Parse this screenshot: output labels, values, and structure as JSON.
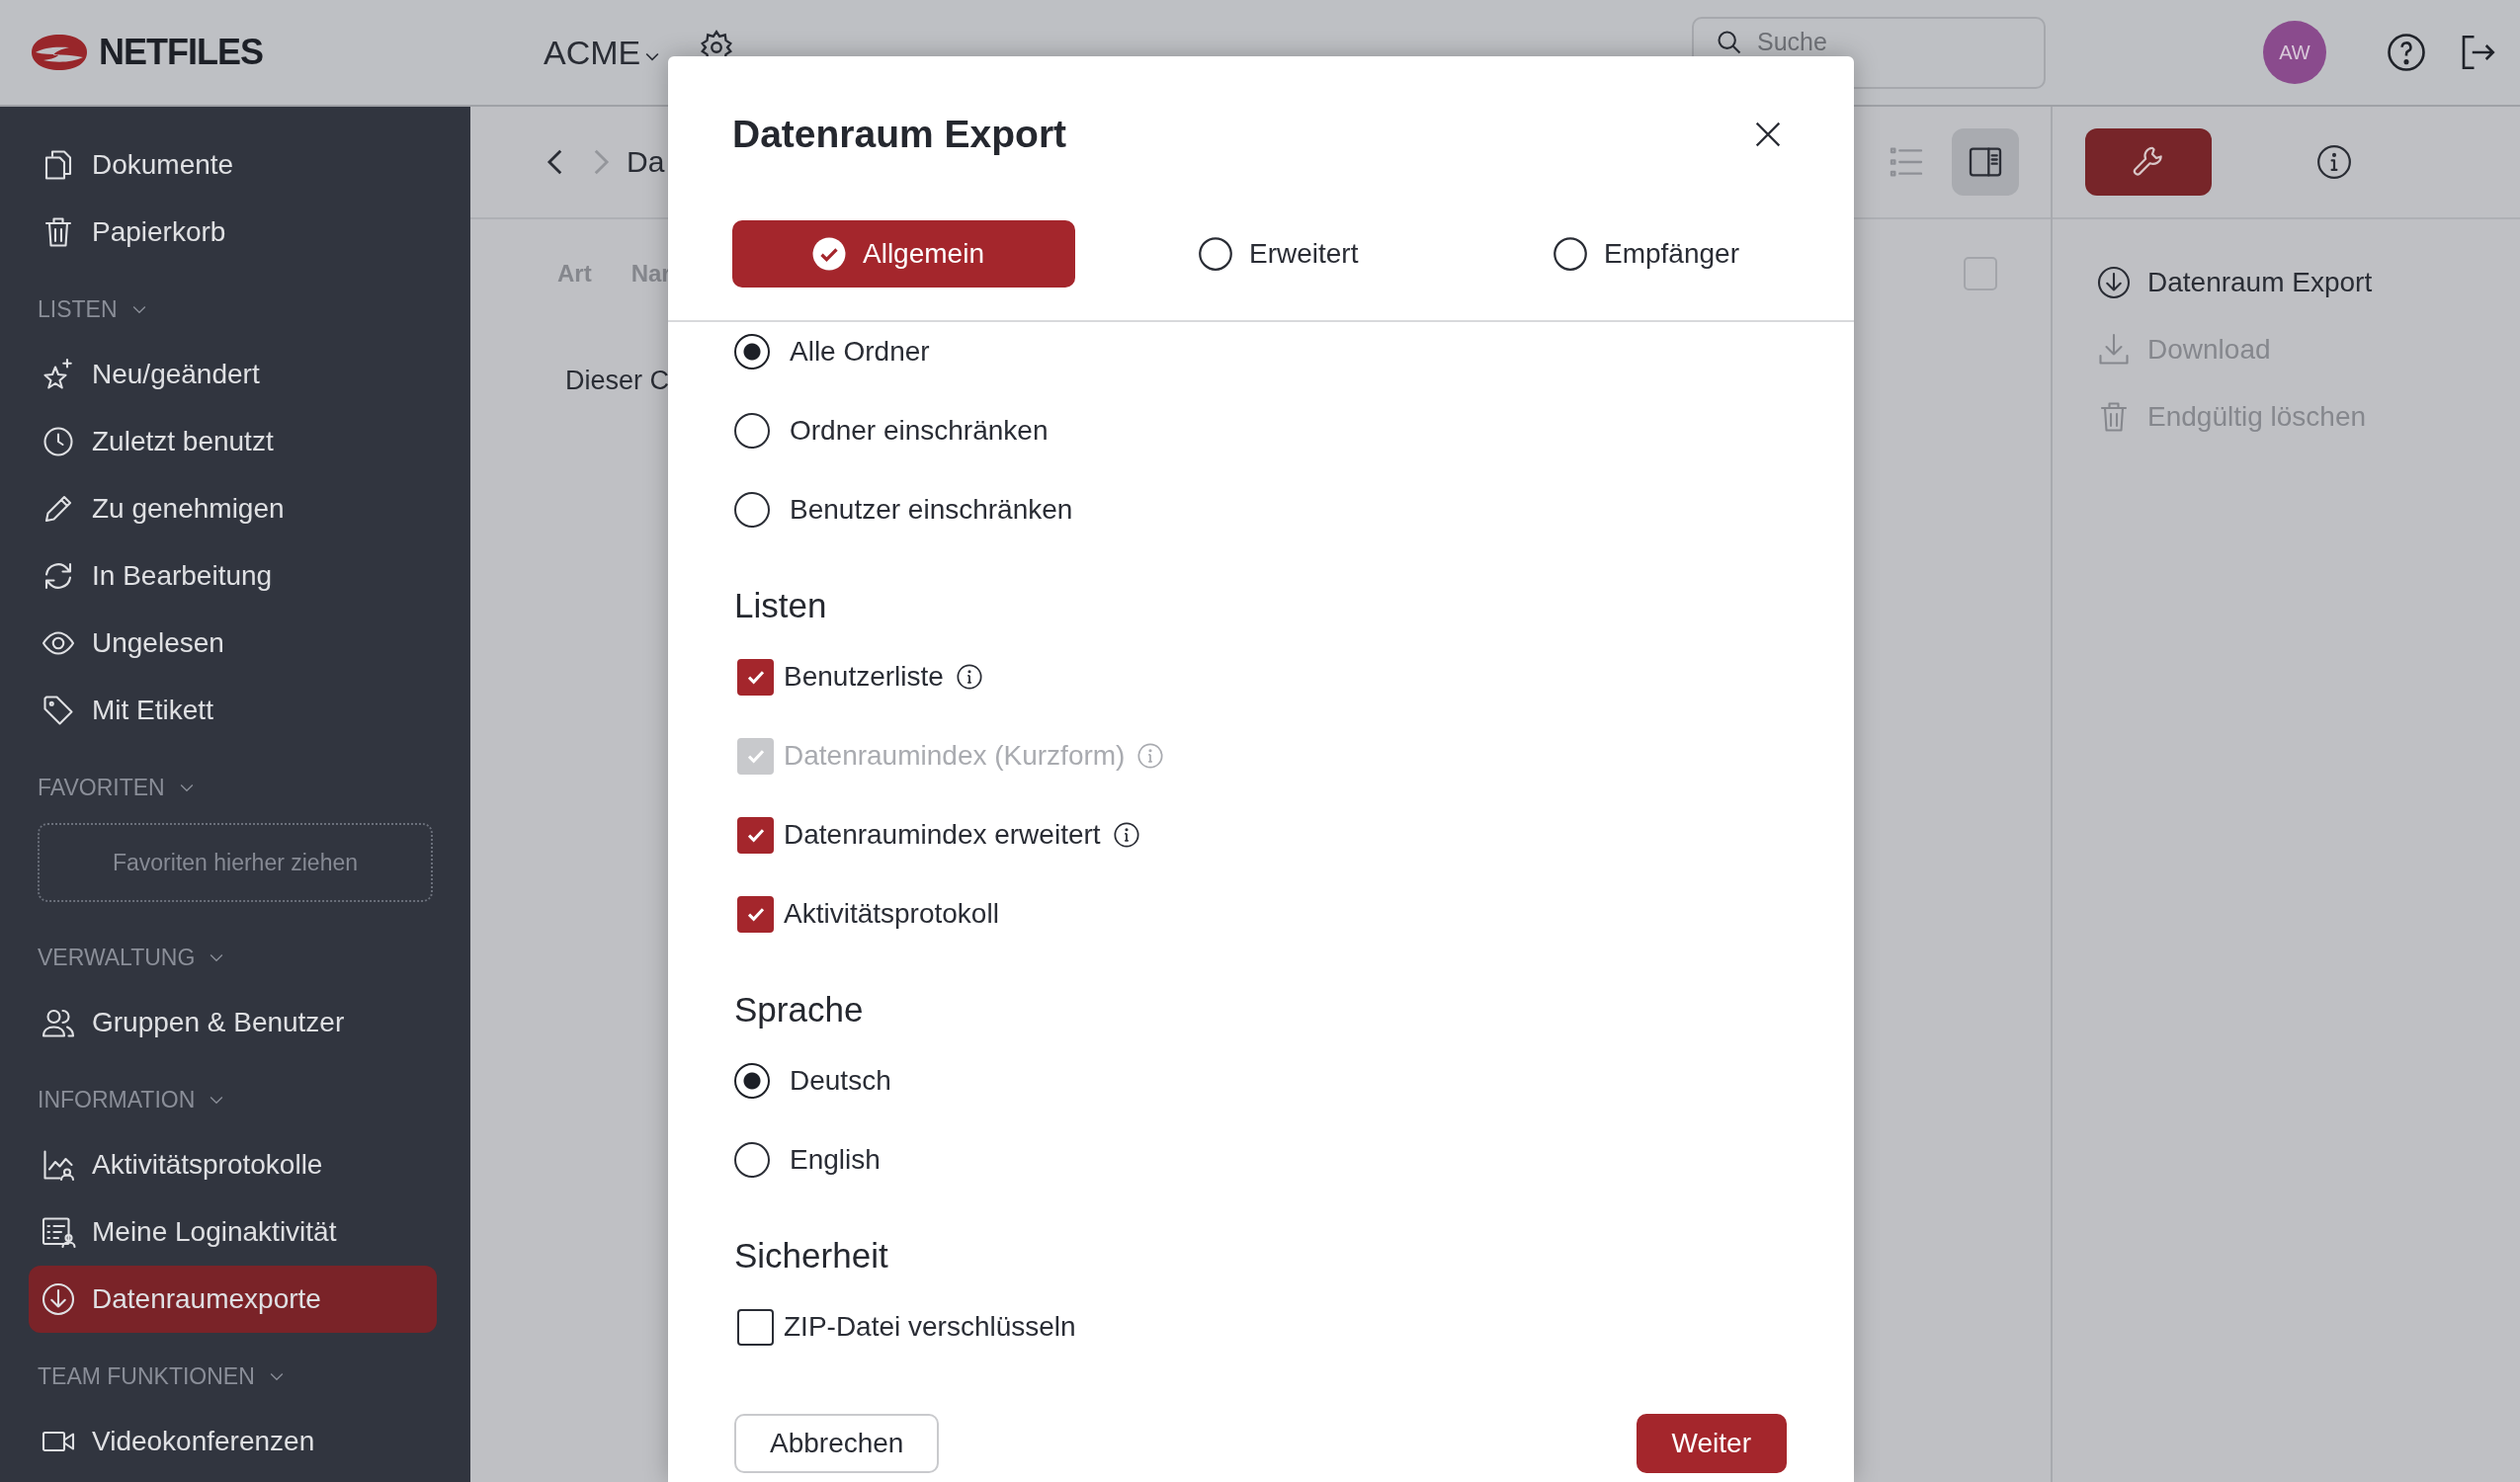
{
  "header": {
    "logo": "NETFILES",
    "workspace": "ACME",
    "search": {
      "placeholder": "Suche"
    },
    "avatar": "AW"
  },
  "sidebar": {
    "items": [
      {
        "label": "Dokumente",
        "selected": false
      },
      {
        "label": "Papierkorb",
        "selected": false
      }
    ],
    "sections": [
      {
        "title": "LISTEN",
        "items": [
          {
            "label": "Neu/geändert",
            "selected": false
          },
          {
            "label": "Zuletzt benutzt",
            "selected": false
          },
          {
            "label": "Zu genehmigen",
            "selected": false
          },
          {
            "label": "In Bearbeitung",
            "selected": false
          },
          {
            "label": "Ungelesen",
            "selected": false
          },
          {
            "label": "Mit Etikett",
            "selected": false
          }
        ]
      },
      {
        "title": "FAVORITEN",
        "dropzone": "Favoriten hierher ziehen"
      },
      {
        "title": "VERWALTUNG",
        "items": [
          {
            "label": "Gruppen & Benutzer",
            "selected": false
          }
        ]
      },
      {
        "title": "INFORMATION",
        "items": [
          {
            "label": "Aktivitätsprotokolle",
            "selected": false
          },
          {
            "label": "Meine Loginaktivität",
            "selected": false
          },
          {
            "label": "Datenraumexporte",
            "selected": true
          }
        ]
      },
      {
        "title": "TEAM FUNKTIONEN",
        "items": [
          {
            "label": "Videokonferenzen",
            "selected": false
          }
        ]
      }
    ]
  },
  "main": {
    "nav": [
      {
        "disabled": false
      },
      {
        "disabled": true
      }
    ],
    "breadcrumb": "Da",
    "view_buttons": [
      {
        "selected": false
      },
      {
        "selected": true
      }
    ],
    "columns": [
      "Art",
      "Nar"
    ],
    "select_all": {
      "checked": false
    },
    "empty_message": "Dieser C"
  },
  "right_panel": {
    "tabs": [
      {
        "selected": true
      },
      {
        "selected": false
      }
    ],
    "actions": [
      {
        "label": "Datenraum Export",
        "disabled": false
      },
      {
        "label": "Download",
        "disabled": true
      },
      {
        "label": "Endgültig löschen",
        "disabled": true
      }
    ]
  },
  "dialog": {
    "title": "Datenraum Export",
    "tabs": [
      {
        "label": "Allgemein",
        "selected": true
      },
      {
        "label": "Erweitert",
        "selected": false
      },
      {
        "label": "Empfänger",
        "selected": false
      }
    ],
    "scope_options": [
      {
        "label": "Alle Ordner",
        "selected": true
      },
      {
        "label": "Ordner einschränken",
        "selected": false
      },
      {
        "label": "Benutzer einschränken",
        "selected": false
      }
    ],
    "lists": {
      "title": "Listen",
      "items": [
        {
          "label": "Benutzerliste",
          "checked": true,
          "disabled": false,
          "info": true
        },
        {
          "label": "Datenraumindex (Kurzform)",
          "checked": true,
          "disabled": true,
          "info": true
        },
        {
          "label": "Datenraumindex erweitert",
          "checked": true,
          "disabled": false,
          "info": true
        },
        {
          "label": "Aktivitätsprotokoll",
          "checked": true,
          "disabled": false,
          "info": false
        }
      ]
    },
    "language": {
      "title": "Sprache",
      "options": [
        {
          "label": "Deutsch",
          "selected": true
        },
        {
          "label": "English",
          "selected": false
        }
      ]
    },
    "security": {
      "title": "Sicherheit",
      "items": [
        {
          "label": "ZIP-Datei verschlüsseln",
          "checked": false,
          "disabled": false,
          "info": false
        }
      ]
    },
    "buttons": {
      "cancel": "Abbrechen",
      "next": "Weiter"
    }
  }
}
